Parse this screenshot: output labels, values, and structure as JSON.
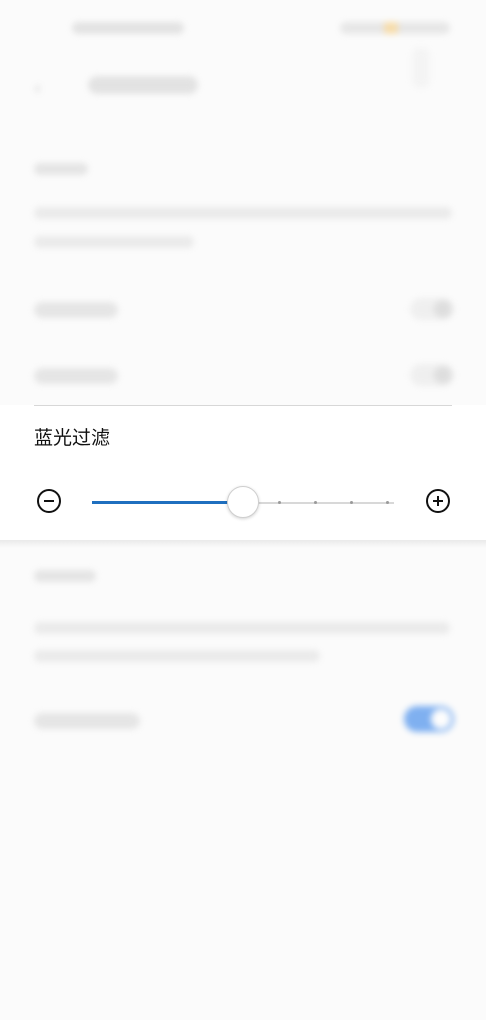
{
  "panel": {
    "title": "蓝光过滤",
    "slider": {
      "value_fraction": 0.5,
      "tick_count": 4,
      "accent_color": "#1f6fbf"
    },
    "minus_icon": "minus-circle-icon",
    "plus_icon": "plus-circle-icon"
  },
  "background": {
    "toggle_on_color": "#1a73e8"
  }
}
